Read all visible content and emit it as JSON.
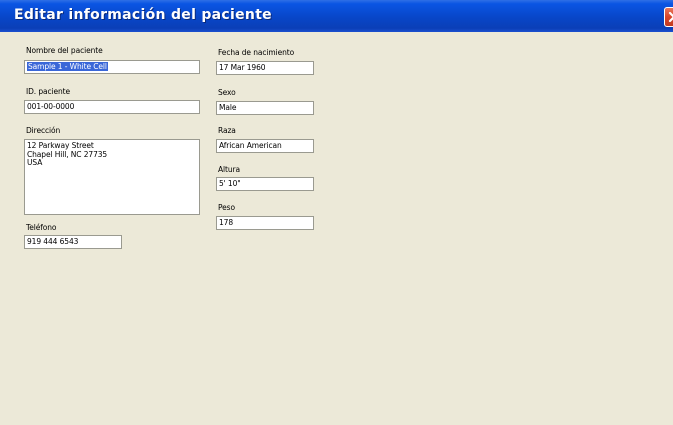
{
  "window": {
    "title": "Editar información del paciente"
  },
  "form": {
    "patient_name": {
      "label": "Nombre del paciente",
      "value": "Sample 1 - White Cell"
    },
    "birth_date": {
      "label": "Fecha de nacimiento",
      "value": "17 Mar 1960"
    },
    "patient_id": {
      "label": "ID. paciente",
      "value": "001-00-0000"
    },
    "sex": {
      "label": "Sexo",
      "value": "Male"
    },
    "address": {
      "label": "Dirección",
      "value": "12 Parkway Street\nChapel Hill, NC 27735\nUSA"
    },
    "race": {
      "label": "Raza",
      "value": "African American"
    },
    "height": {
      "label": "Altura",
      "value": "5' 10\""
    },
    "weight": {
      "label": "Peso",
      "value": "178"
    },
    "phone": {
      "label": "Teléfono",
      "value": "919 444 6543"
    }
  },
  "colors": {
    "titlebar": "#0a55e3",
    "window_background": "#ece9d8",
    "selection": "#3a67d8",
    "close_button": "#d8462b"
  }
}
